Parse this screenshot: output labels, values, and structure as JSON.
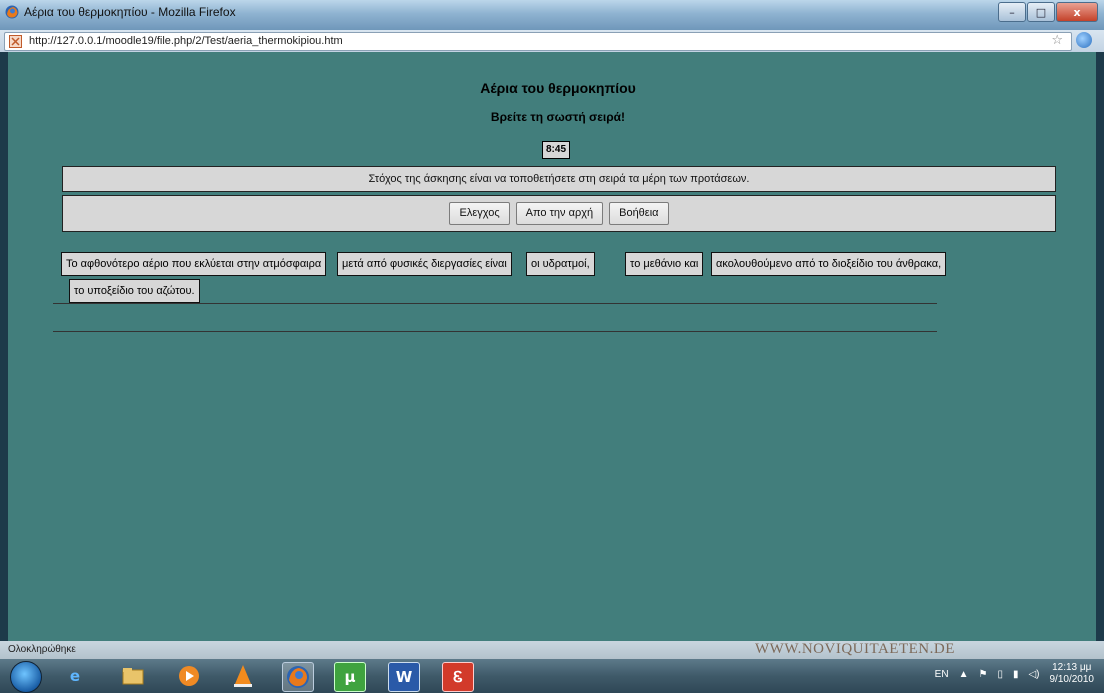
{
  "window": {
    "title": "Αέρια του θερμοκηπίου - Mozilla Firefox",
    "url": "http://127.0.0.1/moodle19/file.php/2/Test/aeria_thermokipiou.htm",
    "minimize": "–",
    "maximize": "□",
    "close": "x"
  },
  "page": {
    "title": "Αέρια του θερμοκηπίου",
    "subtitle": "Βρείτε τη σωστή σειρά!",
    "timer": "8:45",
    "instructions": "Στόχος της άσκησης είναι να τοποθετήσετε στη σειρά τα μέρη των προτάσεων.",
    "buttons": {
      "check": "Ελεγχος",
      "restart": "Απο την αρχή",
      "help": "Βοήθεια"
    },
    "fragments": [
      "Το αφθονότερο αέριο που εκλύεται στην ατμόσφαιρα",
      "μετά από φυσικές διεργασίες είναι",
      "οι υδρατμοί,",
      "το μεθάνιο και",
      "ακολουθούμενο από το διοξείδιο του άνθρακα,",
      "το υποξείδιο του αζώτου."
    ]
  },
  "status": {
    "text": "Ολοκληρώθηκε",
    "watermark": "WWW.NOVIQUITAETEN.DE"
  },
  "taskbar": {
    "apps": [
      "start-orb",
      "internet-explorer-icon",
      "file-explorer-icon",
      "media-player-icon",
      "vlc-icon",
      "firefox-icon",
      "utorrent-icon",
      "word-icon",
      "acrobat-icon"
    ],
    "language": "EN",
    "time": "12:13 μμ",
    "date": "9/10/2010"
  },
  "colors": {
    "page_bg": "#427e7c",
    "panel_bg": "#d7d7d7"
  }
}
